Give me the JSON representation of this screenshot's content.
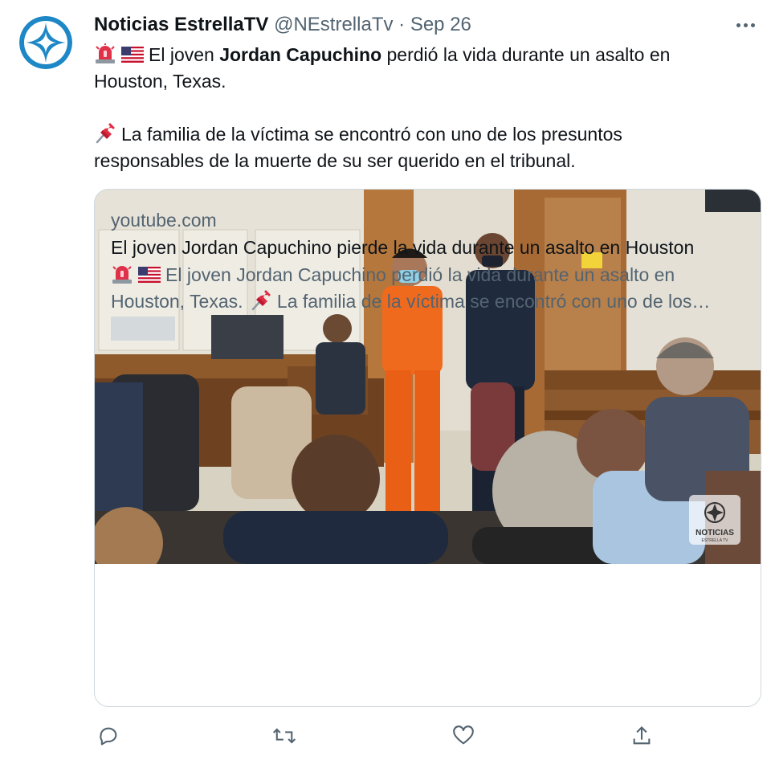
{
  "tweet": {
    "author": {
      "display_name": "Noticias EstrellaTV",
      "handle": "@NEstrellaTv",
      "separator": "·",
      "date": "Sep 26",
      "avatar_icon": "estrella-star-logo",
      "avatar_color": "#1e88c7"
    },
    "more_icon": "ellipsis-icon",
    "text": {
      "line1_prefix": "El joven ",
      "line1_bold": "Jordan Capuchino",
      "line1_suffix": " perdió la vida durante un asalto en",
      "line2": "Houston, Texas.",
      "line3": "La familia de la víctima se encontró con uno de los presuntos",
      "line4": "responsables de la muerte de su ser querido en el tribunal.",
      "emoji_1": "rotating-light-emoji",
      "emoji_2": "us-flag-emoji",
      "emoji_3": "pushpin-emoji"
    },
    "card": {
      "domain": "youtube.com",
      "title": "El joven Jordan Capuchino pierde la vida durante un asalto en Houston",
      "desc_line1": "El joven Jordan Capuchino perdió la vida durante un asalto en",
      "desc_line2_a": "Houston, Texas.",
      "desc_line2_b": "La familia de la víctima se encontró con uno de los…",
      "watermark": "NOTICIAS",
      "watermark_sub": "ESTRELLA TV"
    },
    "actions": {
      "reply_icon": "reply-icon",
      "retweet_icon": "retweet-icon",
      "like_icon": "heart-icon",
      "share_icon": "share-icon"
    },
    "colors": {
      "text": "#0f1419",
      "secondary": "#536471",
      "border": "#cfd9de"
    }
  }
}
